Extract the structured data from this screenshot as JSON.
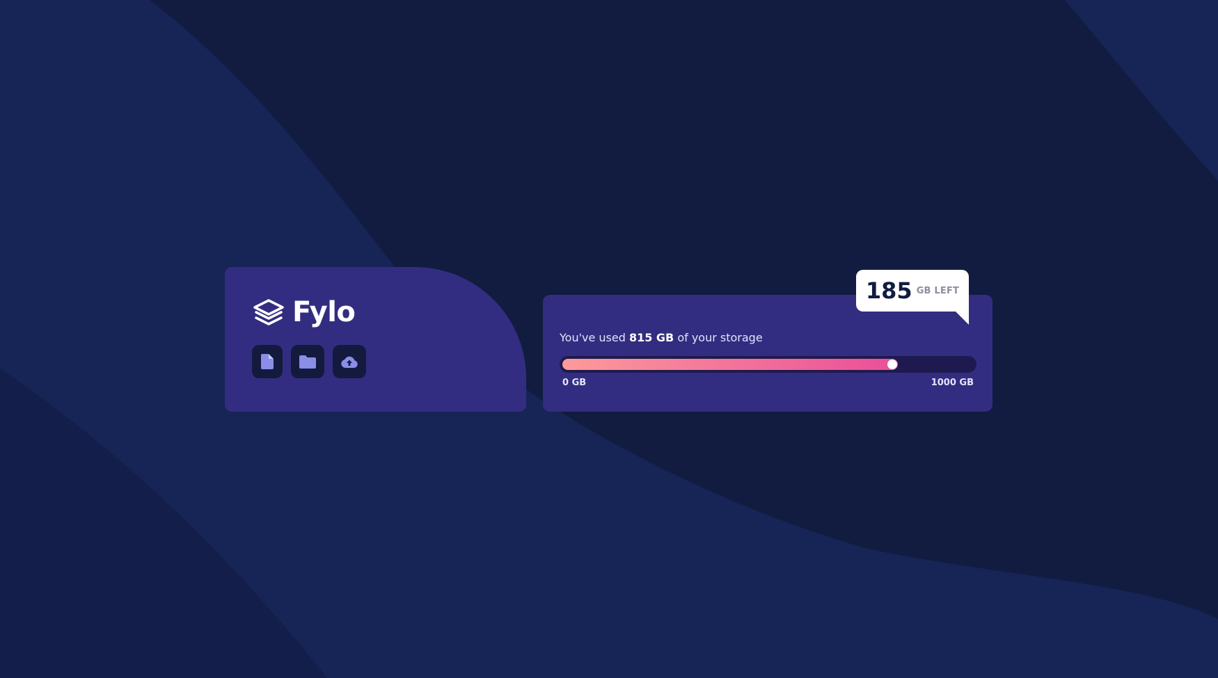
{
  "brand": {
    "name": "Fylo",
    "logo_icon": "layers-icon"
  },
  "actions": [
    {
      "icon": "document-icon"
    },
    {
      "icon": "folder-icon"
    },
    {
      "icon": "cloud-upload-icon"
    }
  ],
  "storage": {
    "used_prefix": "You've used ",
    "used_amount": "815 GB",
    "used_suffix": " of your storage",
    "used_fraction": 0.815,
    "scale_min": "0 GB",
    "scale_max": "1000 GB",
    "remaining_value": "185",
    "remaining_unit": "GB LEFT"
  },
  "colors": {
    "background": "#111c40",
    "card": "#332d81",
    "bar_start": "#fb9b9a",
    "bar_end": "#ea4e99",
    "icon_accent": "#8a8ee8"
  }
}
